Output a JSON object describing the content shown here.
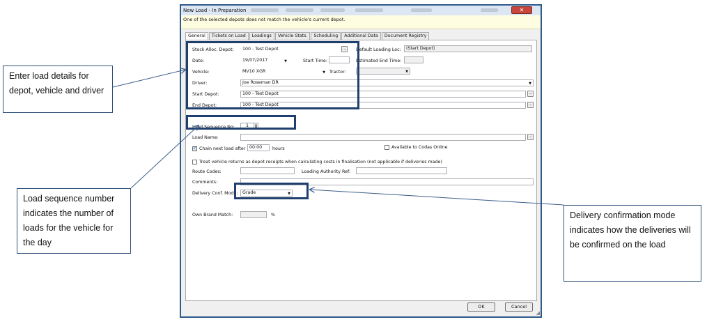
{
  "window": {
    "title": "New Load - In Preparation",
    "warning": "One of the selected depots does not match the vehicle's current depot."
  },
  "tabs": [
    "General",
    "Tickets on Load",
    "Loadings",
    "Vehicle Stats.",
    "Scheduling",
    "Additional Data",
    "Document Registry"
  ],
  "form": {
    "stock_alloc_depot_label": "Stock Alloc. Depot:",
    "stock_alloc_depot_value": "100 - Test Depot",
    "default_loading_loc_label": "Default Loading Loc:",
    "default_loading_loc_value": "(Start Depot)",
    "date_label": "Date:",
    "date_value": "19/07/2017",
    "start_time_label": "Start Time:",
    "estimated_end_time_label": "Estimated End Time:",
    "vehicle_label": "Vehicle:",
    "vehicle_value": "MV10 XGR",
    "tractor_label": "Tractor:",
    "driver_label": "Driver:",
    "driver_value": "Joe  Roseman  DR",
    "start_depot_label": "Start Depot:",
    "start_depot_value": "100 - Test Depot",
    "end_depot_label": "End Depot:",
    "end_depot_value": "100 - Test Depot",
    "load_sequence_label": "Load Sequence No:",
    "load_sequence_value": "1",
    "load_name_label": "Load Name:",
    "chain_label": "Chain next load after",
    "chain_time": "00:00",
    "hours_label": "hours",
    "available_codas_label": "Available to Codas Online",
    "treat_returns_label": "Treat vehicle returns as depot receipts when calculating costs in finalisation (not applicable if deliveries made)",
    "route_codes_label": "Route Codes:",
    "loading_authority_label": "Loading Authority Ref:",
    "comments_label": "Comments:",
    "delivery_conf_mode_label": "Delivery Conf. Mode:",
    "delivery_conf_mode_value": "Grade",
    "own_brand_label": "Own Brand Match:",
    "percent_label": "%"
  },
  "buttons": {
    "ok": "OK",
    "cancel": "Cancel",
    "ellipsis": "..."
  },
  "callouts": {
    "left_top": "Enter load details for depot, vehicle and driver",
    "left_bottom": "Load sequence number indicates the number of loads for the vehicle for the day",
    "right": "Delivery confirmation mode indicates how the deliveries will be confirmed on the load"
  },
  "colors": {
    "highlight": "#1f3f6e",
    "window_border": "#2e5a8c",
    "warning_bg": "#fffde1",
    "close_button": "#c9463d"
  }
}
